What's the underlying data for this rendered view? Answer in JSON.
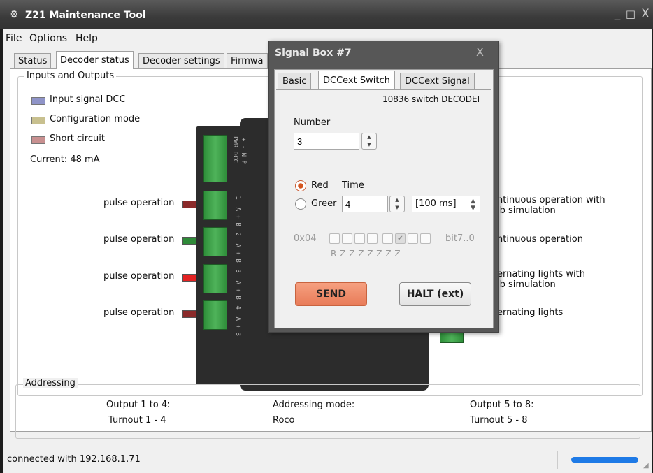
{
  "window": {
    "title": "Z21 Maintenance Tool",
    "minimize": "_",
    "maximize": "□",
    "close": "X",
    "icon": "z21-icon"
  },
  "menu": {
    "file": "File",
    "options": "Options",
    "help": "Help"
  },
  "tabs": {
    "status": "Status",
    "decoder_status": "Decoder status",
    "decoder_settings": "Decoder settings",
    "firmware": "Firmwa"
  },
  "inputs_outputs": {
    "title": "Inputs and Outputs",
    "legend": [
      {
        "label": "Input signal DCC",
        "color": "#8f94c8"
      },
      {
        "label": "Configuration mode",
        "color": "#c8c08f"
      },
      {
        "label": "Short circuit",
        "color": "#c89090"
      }
    ],
    "current": "Current: 48 mA",
    "left_outputs": [
      {
        "label": "pulse operation",
        "led": "#8a2a2a"
      },
      {
        "label": "pulse operation",
        "led": "#2e8a38"
      },
      {
        "label": "pulse operation",
        "led": "#e32222"
      },
      {
        "label": "pulse operation",
        "led": "#8a2a2a"
      }
    ],
    "right_outputs": [
      {
        "line1": "ntinuous operation with",
        "line2": "lb simulation"
      },
      {
        "line1": "ntinuous operation",
        "line2": ""
      },
      {
        "line1": "ernating lights with",
        "line2": "lb simulation"
      },
      {
        "line1": "ernating lights",
        "line2": ""
      }
    ],
    "connector_pwr": "PWR DCC",
    "connector_pwr2": "+ - N P",
    "connector_labels": [
      "—1— A + B",
      "—2— A + B",
      "—3— A + B",
      "—4— A + B"
    ],
    "connector_small": "| A"
  },
  "addressing": {
    "title": "Addressing",
    "col1_head": "Output 1 to 4:",
    "col1_val": "Turnout 1 - 4",
    "col2_head": "Addressing mode:",
    "col2_val": "Roco",
    "col3_head": "Output 5 to 8:",
    "col3_val": "Turnout 5 - 8"
  },
  "status": {
    "text": "connected with 192.168.1.71",
    "progress": 1.0
  },
  "dialog": {
    "title": "Signal Box #7",
    "close": "X",
    "tabs": {
      "basic": "Basic",
      "dccext_switch": "DCCext Switch",
      "dccext_signal": "DCCext Signal"
    },
    "decoder": "10836 switch DECODEI",
    "number_label": "Number",
    "number_value": "3",
    "radio_red": "Red",
    "radio_green": "Greer",
    "time_label": "Time",
    "time_value": "4",
    "time_unit": "[100 ms]",
    "hex": "0x04",
    "bits_label": "bit7..0",
    "bit_letters": "R  Z  Z  Z   Z  Z  Z  Z",
    "bits_checked": [
      false,
      false,
      false,
      false,
      false,
      true,
      false,
      false
    ],
    "send": "SEND",
    "halt": "HALT (ext)"
  }
}
